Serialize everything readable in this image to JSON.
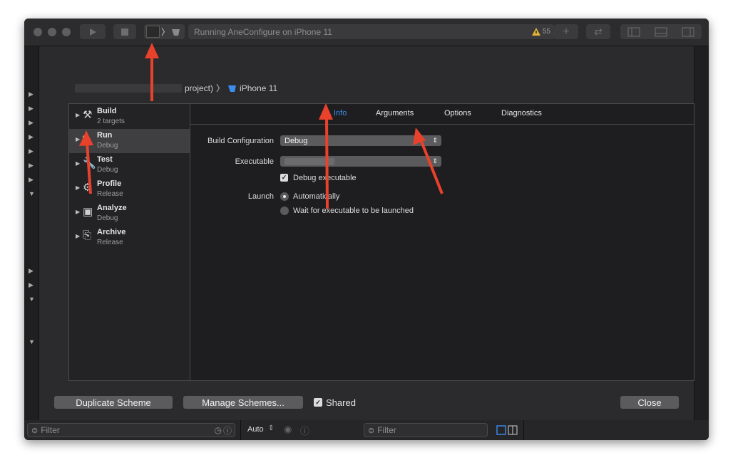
{
  "toolbar": {
    "scheme_name": "",
    "status_text": "Running AneConfigure on iPhone 11",
    "warning_count": "55"
  },
  "breadcrumb": {
    "project_text": "project)",
    "device": "iPhone 11"
  },
  "actions": [
    {
      "name": "Build",
      "sub": "2 targets",
      "icon": "hammer-icon"
    },
    {
      "name": "Run",
      "sub": "Debug",
      "icon": "play-icon"
    },
    {
      "name": "Test",
      "sub": "Debug",
      "icon": "wrench-icon"
    },
    {
      "name": "Profile",
      "sub": "Release",
      "icon": "instruments-icon"
    },
    {
      "name": "Analyze",
      "sub": "Debug",
      "icon": "analyze-icon"
    },
    {
      "name": "Archive",
      "sub": "Release",
      "icon": "archive-icon"
    }
  ],
  "tabs": {
    "info": "Info",
    "arguments": "Arguments",
    "options": "Options",
    "diagnostics": "Diagnostics"
  },
  "info": {
    "build_config_label": "Build Configuration",
    "build_config_value": "Debug",
    "executable_label": "Executable",
    "executable_value": "",
    "debug_executable_label": "Debug executable",
    "launch_label": "Launch",
    "launch_auto": "Automatically",
    "launch_wait": "Wait for executable to be launched"
  },
  "footer": {
    "duplicate": "Duplicate Scheme",
    "manage": "Manage Schemes...",
    "shared": "Shared",
    "close": "Close"
  },
  "bottombar": {
    "filter_placeholder": "Filter",
    "auto_label": "Auto",
    "filter2_placeholder": "Filter"
  },
  "colors": {
    "accent": "#3b8ef0",
    "annotation_arrow": "#e8412c"
  }
}
